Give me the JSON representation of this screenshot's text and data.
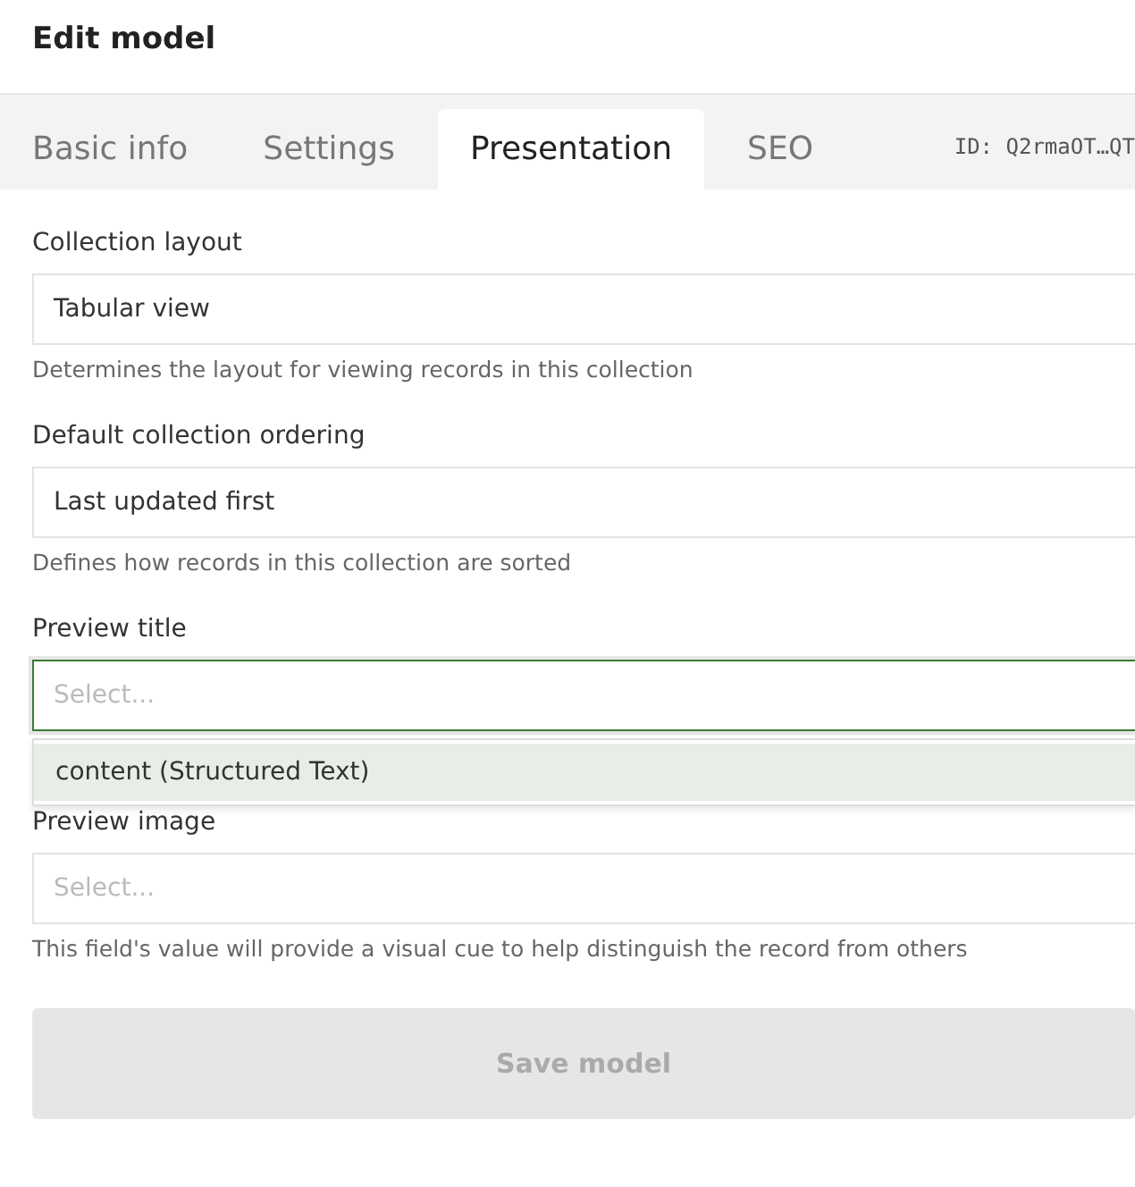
{
  "dialog": {
    "title": "Edit model"
  },
  "tabs": [
    {
      "label": "Basic info",
      "selected": false
    },
    {
      "label": "Settings",
      "selected": false
    },
    {
      "label": "Presentation",
      "selected": true
    },
    {
      "label": "SEO",
      "selected": false
    }
  ],
  "model_id": "ID: Q2rmaOT…QT",
  "fields": [
    {
      "label": "Collection layout",
      "value": "Tabular view",
      "hint": "Determines the layout for viewing records in this collection",
      "focused": false
    },
    {
      "label": "Default collection ordering",
      "value": "Last updated first",
      "hint": "Defines how records in this collection are sorted",
      "focused": false
    },
    {
      "label": "Preview title",
      "placeholder": "Select...",
      "focused": true,
      "options": [
        {
          "label": "content (Structured Text)",
          "selected": true
        }
      ]
    },
    {
      "label": "Preview image",
      "placeholder": "Select...",
      "hint": "This field's value will provide a visual cue to help distinguish the record from others",
      "focused": false
    }
  ],
  "save_button": {
    "label": "Save model",
    "disabled": true
  }
}
